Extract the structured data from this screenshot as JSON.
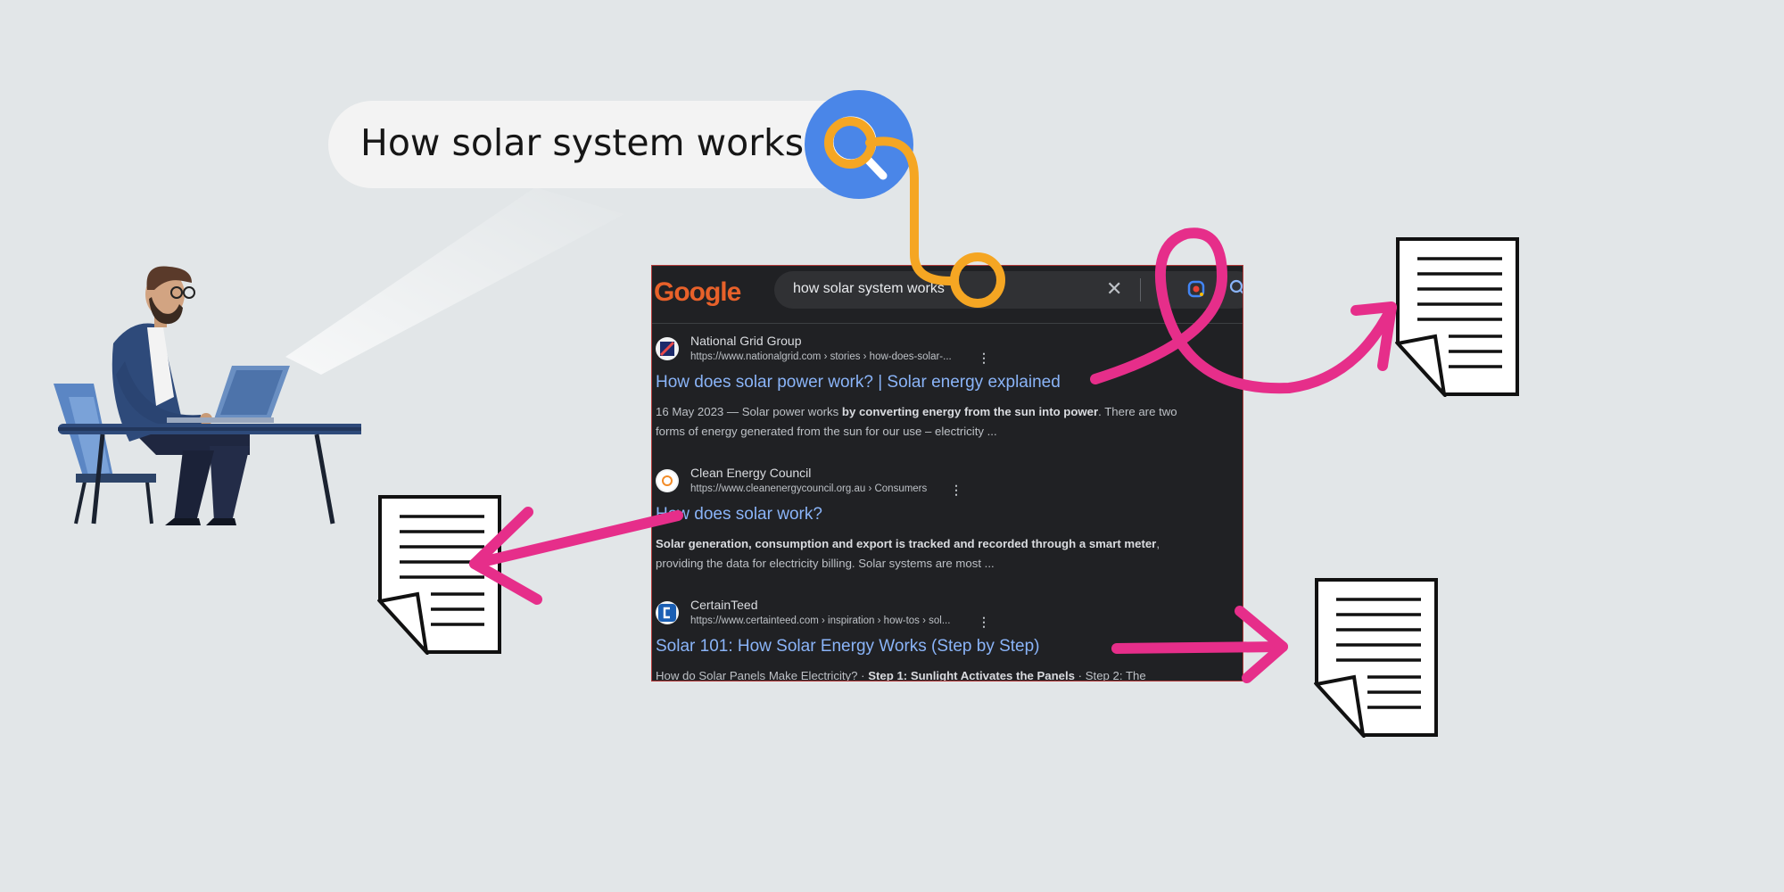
{
  "search": {
    "query": "How solar system works"
  },
  "google": {
    "logo_text": "Google",
    "query": "how solar system works",
    "clear_symbol": "✕"
  },
  "results": [
    {
      "site": "National Grid Group",
      "url": "https://www.nationalgrid.com › stories › how-does-solar-...",
      "title": "How does solar power work? | Solar energy explained",
      "snippet_pre": "16 May 2023 — Solar power works ",
      "snippet_bold": "by converting energy from the sun into power",
      "snippet_post": ". There are two forms of energy generated from the sun for our use – electricity ..."
    },
    {
      "site": "Clean Energy Council",
      "url": "https://www.cleanenergycouncil.org.au › Consumers",
      "title": "How does solar work?",
      "snippet_pre": "",
      "snippet_bold": "Solar generation, consumption and export is tracked and recorded through a smart meter",
      "snippet_post": ", providing the data for electricity billing. Solar systems are most ..."
    },
    {
      "site": "CertainTeed",
      "url": "https://www.certainteed.com › inspiration › how-tos › sol...",
      "title": "Solar 101: How Solar Energy Works (Step by Step)",
      "snippet_pre": "How do Solar Panels Make Electricity? · ",
      "snippet_bold": "Step 1: Sunlight Activates the Panels",
      "snippet_post": " · Step 2: The"
    }
  ],
  "colors": {
    "background": "#e2e6e8",
    "search_button": "#4a86e8",
    "connector_orange": "#f5a623",
    "arrow_pink": "#e62e8a",
    "result_title": "#8ab4f8"
  },
  "icons": {
    "search_button": "magnifier-icon",
    "document": "document-icon",
    "person": "person-at-laptop-illustration"
  }
}
